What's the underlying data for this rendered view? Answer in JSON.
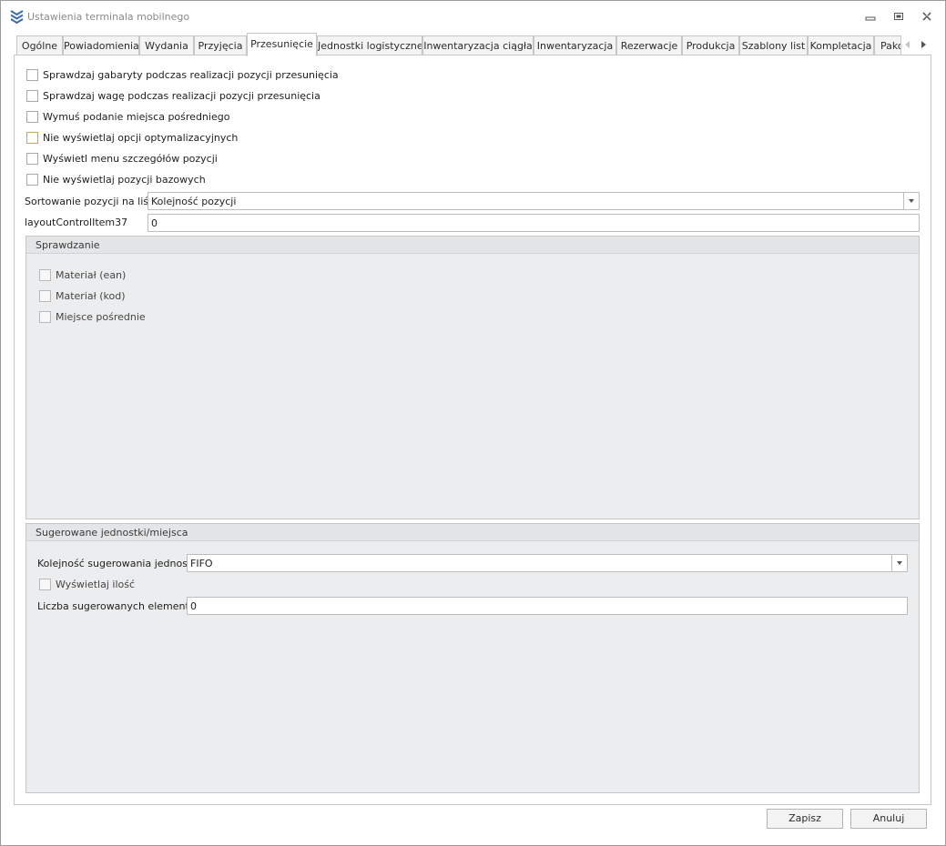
{
  "window": {
    "title": "Ustawienia terminala mobilnego",
    "icons": {
      "app": "stacked-chevrons-icon",
      "minimize": "minimize-icon",
      "restore": "restore-icon",
      "close": "close-icon"
    }
  },
  "tabs": [
    {
      "label": "Ogólne"
    },
    {
      "label": "Powiadomienia"
    },
    {
      "label": "Wydania"
    },
    {
      "label": "Przyjęcia"
    },
    {
      "label": "Przesunięcie",
      "active": true
    },
    {
      "label": "Jednostki logistyczne"
    },
    {
      "label": "Inwentaryzacja ciągła"
    },
    {
      "label": "Inwentaryzacja"
    },
    {
      "label": "Rezerwacje"
    },
    {
      "label": "Produkcja"
    },
    {
      "label": "Szablony list"
    },
    {
      "label": "Kompletacja"
    },
    {
      "label": "Pako"
    }
  ],
  "options": [
    {
      "label": "Sprawdzaj gabaryty podczas realizacji pozycji przesunięcia",
      "checked": false
    },
    {
      "label": "Sprawdzaj wagę podczas realizacji pozycji przesunięcia",
      "checked": false
    },
    {
      "label": "Wymuś podanie miejsca pośredniego",
      "checked": false
    },
    {
      "label": "Nie wyświetlaj opcji optymalizacyjnych",
      "checked": false
    },
    {
      "label": "Wyświetl menu szczegółów pozycji",
      "checked": false
    },
    {
      "label": "Nie wyświetlaj pozycji bazowych",
      "checked": false
    }
  ],
  "sort": {
    "label": "Sortowanie pozycji na liście",
    "value": "Kolejność pozycji"
  },
  "layout_item": {
    "label": "layoutControlItem37",
    "value": "0"
  },
  "checking_group": {
    "title": "Sprawdzanie",
    "items": [
      {
        "label": "Materiał (ean)",
        "checked": false
      },
      {
        "label": "Materiał (kod)",
        "checked": false
      },
      {
        "label": "Miejsce pośrednie",
        "checked": false
      }
    ]
  },
  "suggested_group": {
    "title": "Sugerowane jednostki/miejsca",
    "order_label": "Kolejność sugerowania jednostek",
    "order_value": "FIFO",
    "show_qty_label": "Wyświetlaj ilość",
    "count_label": "Liczba sugerowanych elementów",
    "count_value": "0"
  },
  "footer": {
    "save": "Zapisz",
    "cancel": "Anuluj"
  },
  "colors": {
    "border": "#c6c6c6",
    "group_bg": "#ecedee",
    "icon_blue": "#3d6aa8"
  }
}
